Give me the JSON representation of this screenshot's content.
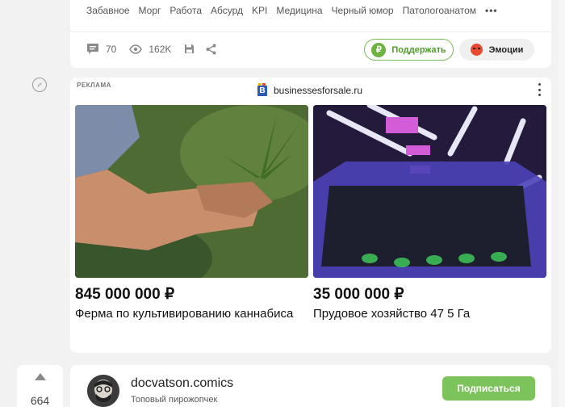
{
  "post": {
    "tags": [
      "Забавное",
      "Морг",
      "Работа",
      "Абсурд",
      "KPI",
      "Медицина",
      "Черный юмор",
      "Патологоанатом"
    ],
    "more_label": "•••",
    "comments_count": "70",
    "views_count": "162K",
    "support_label": "Поддержать",
    "support_icon": "₽",
    "emotion_label": "Эмоции",
    "colors": {
      "support_green": "#76b852",
      "subscribe_green": "#7dc35b",
      "emotion_red": "#e8492f"
    }
  },
  "ad": {
    "label": "РЕКЛАМА",
    "source": "businessesforsale.ru",
    "source_logo_letter": "B",
    "items": [
      {
        "price": "845 000 000 ₽",
        "title": "Ферма по культивированию каннабиса"
      },
      {
        "price": "35 000 000 ₽",
        "title": "Прудовое хозяйство 47 5 Га"
      }
    ]
  },
  "next_post": {
    "vote_count": "664",
    "author_name": "docvatson.comics",
    "author_subtitle": "Топовый пирожопчек",
    "subscribe_label": "Подписаться"
  }
}
